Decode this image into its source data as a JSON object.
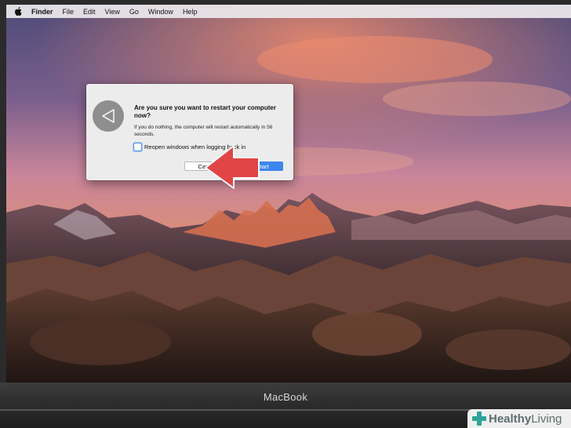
{
  "menubar": {
    "items": [
      "Finder",
      "File",
      "Edit",
      "View",
      "Go",
      "Window",
      "Help"
    ]
  },
  "dialog": {
    "title": "Are you sure you want to restart your computer now?",
    "message": "If you do nothing, the computer will restart automatically in 56 seconds.",
    "checkbox_label": "Reopen windows when logging back in",
    "checkbox_checked": false,
    "cancel_label": "Cancel",
    "restart_label": "Restart"
  },
  "device_label": "MacBook",
  "watermark": {
    "brand": "Healthy",
    "brand2": " Living"
  },
  "colors": {
    "accent": "#3b86ef",
    "arrow": "#e24545",
    "dialog_bg": "#ececec"
  }
}
